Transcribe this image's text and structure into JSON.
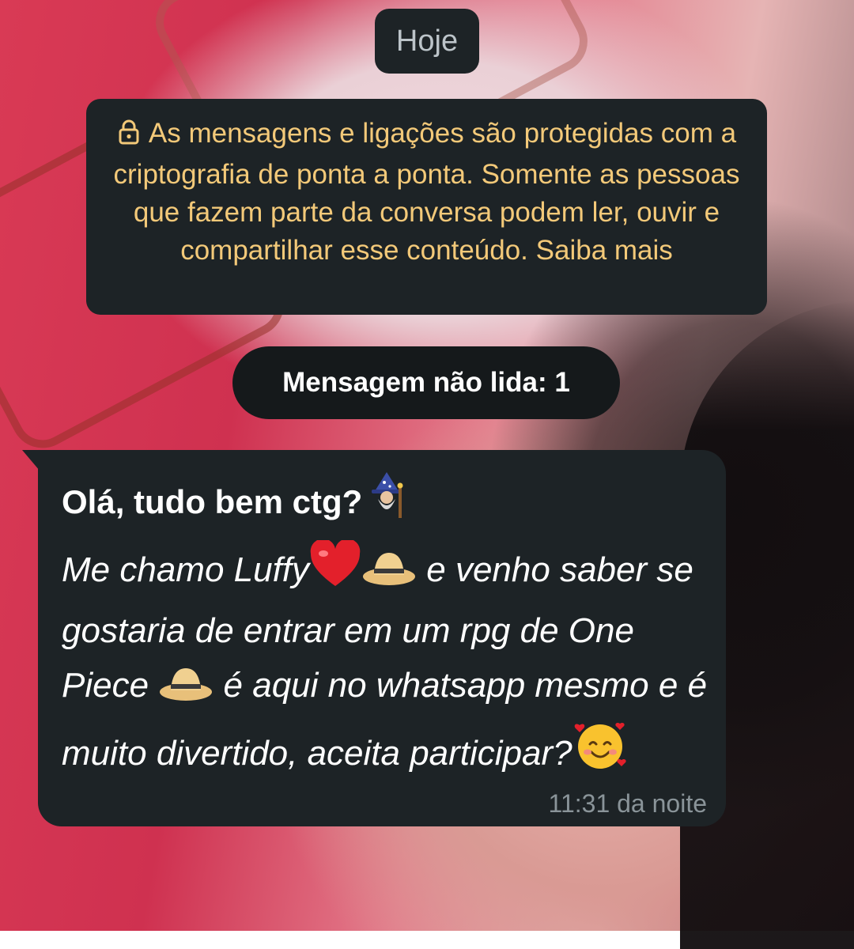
{
  "chat": {
    "date_label": "Hoje",
    "encryption_notice": "As mensagens e ligações são protegidas com a criptografia de ponta a ponta. Somente as pessoas que fazem parte da conversa podem ler, ouvir e compartilhar esse conteúdo.",
    "encryption_link": "Saiba mais",
    "unread_label": "Mensagem não lida: 1"
  },
  "message": {
    "title": "Olá, tudo bem ctg?",
    "body_part1": "Me chamo Luffy",
    "body_part2": "e venho saber se gostaria de entrar em um rpg de One Piece",
    "body_part3": "é aqui no whatsapp mesmo e é muito divertido, aceita participar?",
    "time": "11:31 da noite"
  },
  "icons": {
    "lock": "lock-icon",
    "wizard": "mage-emoji",
    "heart": "red-heart-emoji",
    "hat": "straw-hat-emoji",
    "smile": "smiling-face-with-hearts-emoji"
  },
  "colors": {
    "bubble_bg": "#1d2326",
    "notice_text": "#f3c979",
    "time_text": "#8a9499"
  }
}
